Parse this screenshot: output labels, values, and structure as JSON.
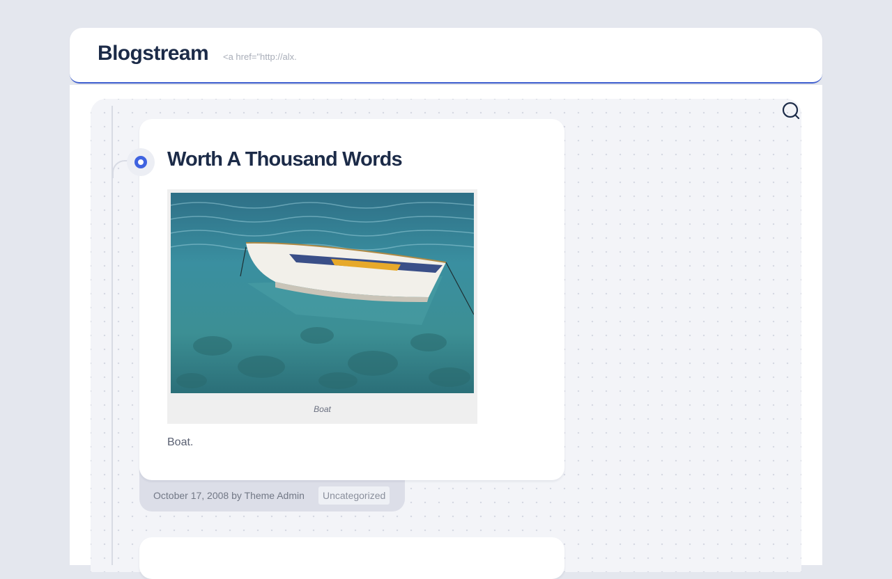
{
  "header": {
    "site_title": "Blogstream",
    "site_description": "<a href=\"http://alx."
  },
  "search": {
    "icon": "search-icon"
  },
  "post": {
    "title": "Worth A Thousand Words",
    "image_caption": "Boat",
    "excerpt": "Boat.",
    "meta": {
      "date": "October 17, 2008",
      "by": "by",
      "author": "Theme Admin",
      "category": "Uncategorized"
    }
  },
  "colors": {
    "accent": "#3f63e0",
    "title": "#1c2b48",
    "background": "#e4e7ee"
  }
}
